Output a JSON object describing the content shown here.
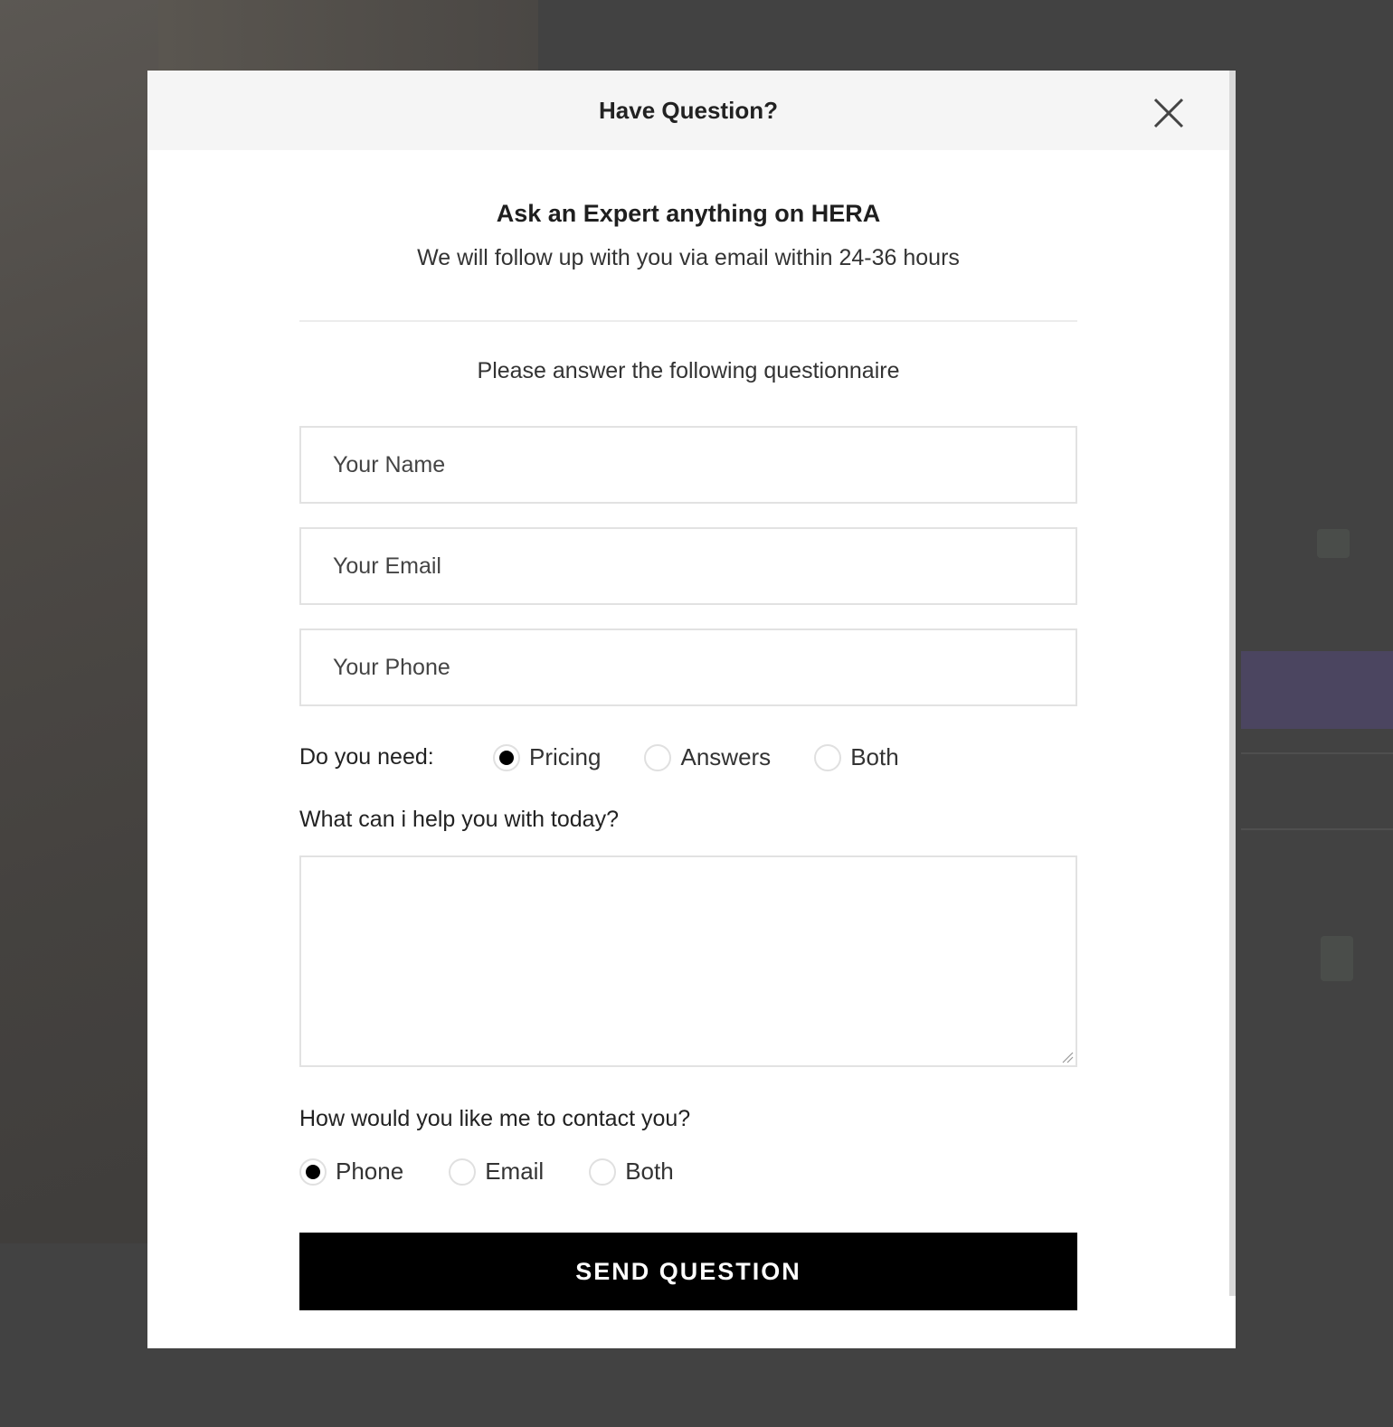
{
  "modal": {
    "title": "Have Question?",
    "intro_title": "Ask an Expert anything on HERA",
    "intro_subtitle": "We will follow up with you via email within 24-36 hours",
    "questionnaire_text": "Please answer the following questionnaire",
    "fields": {
      "name_placeholder": "Your Name",
      "email_placeholder": "Your Email",
      "phone_placeholder": "Your Phone"
    },
    "need": {
      "label": "Do you need:",
      "options": [
        "Pricing",
        "Answers",
        "Both"
      ],
      "selected": "Pricing"
    },
    "help_label": "What can i help you with today?",
    "message_value": "",
    "contact": {
      "label": "How would you like me to contact you?",
      "options": [
        "Phone",
        "Email",
        "Both"
      ],
      "selected": "Phone"
    },
    "submit_label": "SEND QUESTION"
  },
  "icons": {
    "close": "close-icon",
    "resize": "resize-grip-icon"
  },
  "colors": {
    "overlay": "#424242",
    "modal_header_bg": "#f5f5f5",
    "button_bg": "#000000",
    "button_text": "#ffffff",
    "input_border": "#e2e2e2"
  }
}
